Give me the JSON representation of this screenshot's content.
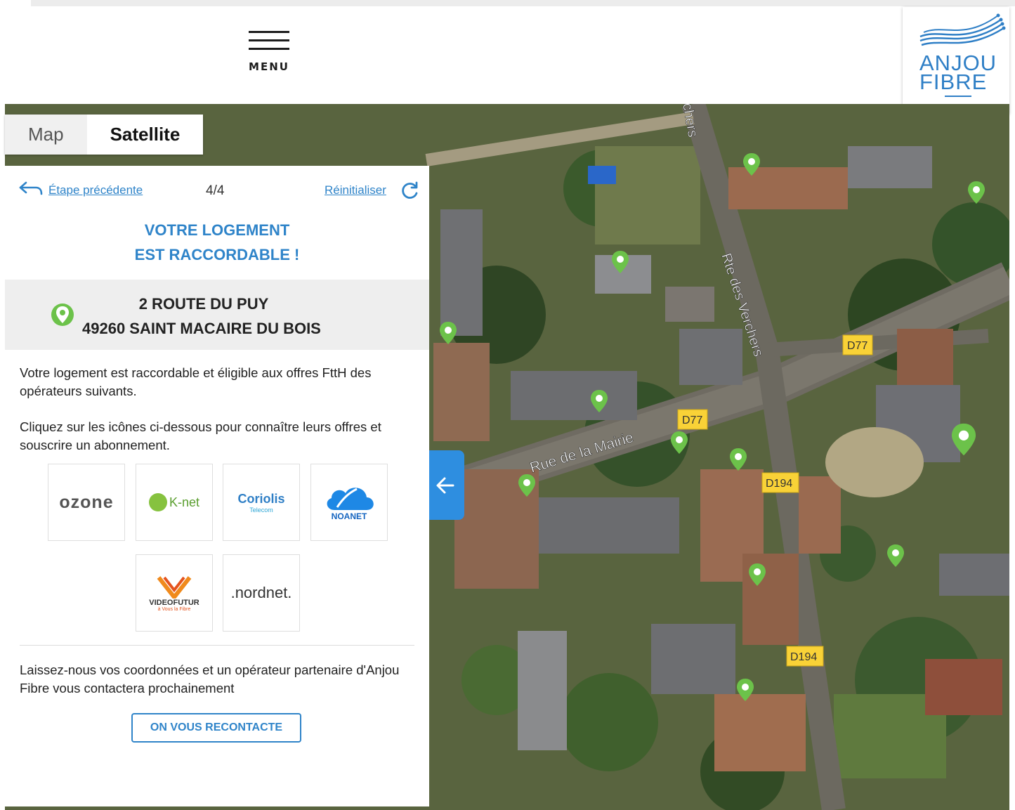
{
  "header": {
    "menu_label": "MENU",
    "logo_line1": "ANJOU",
    "logo_line2": "FIBRE"
  },
  "map": {
    "type_tabs": [
      {
        "label": "Map",
        "active": false
      },
      {
        "label": "Satellite",
        "active": true
      }
    ],
    "street_labels": [
      "Rue de la Mairie",
      "Rte des Verchers",
      "chers"
    ],
    "road_badges": [
      "D77",
      "D77",
      "D194",
      "D194"
    ]
  },
  "panel": {
    "back_label": "Étape précédente",
    "step": "4/4",
    "reset_label": "Réinitialiser",
    "title_line1": "VOTRE LOGEMENT",
    "title_line2": "EST RACCORDABLE !",
    "address_line1": "2  ROUTE DU PUY",
    "address_line2": "49260 SAINT MACAIRE DU BOIS",
    "para1": "Votre logement est raccordable et éligible aux offres FttH des opérateurs suivants.",
    "para2": "Cliquez sur les icônes ci-dessous pour connaître leurs offres et souscrire un abonnement.",
    "operators": [
      "ozone",
      "K-net",
      "Coriolis",
      "NOANET",
      "VIDEOFUTUR",
      ".nordnet."
    ],
    "operator_subtitles": {
      "coriolis": "Telecom",
      "videofutur": "à Vous la Fibre"
    },
    "para3": "Laissez-nous vos coordonnées et un opérateur partenaire d'Anjou Fibre vous contactera prochainement",
    "cta_label": "ON VOUS RECONTACTE"
  },
  "colors": {
    "accent": "#2f84c9",
    "marker_green": "#6cc24a",
    "badge_yellow": "#f9d237",
    "collapse_blue": "#2e8ee0"
  },
  "icons": [
    "back-arrow-icon",
    "reload-icon",
    "location-pin-icon",
    "arrow-left-icon",
    "map-marker-icon"
  ]
}
